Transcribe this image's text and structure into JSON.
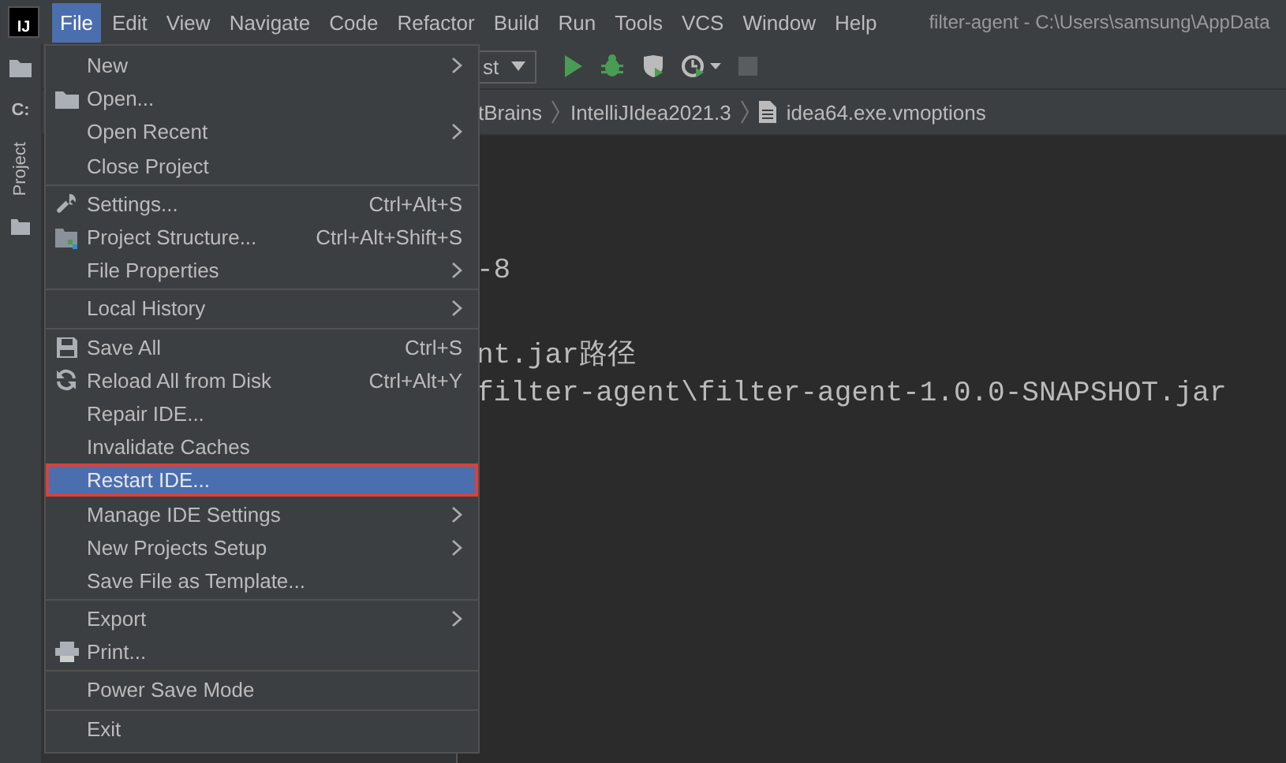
{
  "app_logo": "IJ",
  "menubar": [
    {
      "label": "File",
      "selected": true
    },
    {
      "label": "Edit",
      "selected": false
    },
    {
      "label": "View",
      "selected": false
    },
    {
      "label": "Navigate",
      "selected": false
    },
    {
      "label": "Code",
      "selected": false
    },
    {
      "label": "Refactor",
      "selected": false
    },
    {
      "label": "Build",
      "selected": false
    },
    {
      "label": "Run",
      "selected": false
    },
    {
      "label": "Tools",
      "selected": false
    },
    {
      "label": "VCS",
      "selected": false
    },
    {
      "label": "Window",
      "selected": false
    },
    {
      "label": "Help",
      "selected": false
    }
  ],
  "window": {
    "title": "filter-agent - C:\\Users\\samsung\\AppData"
  },
  "sidebar": {
    "drive_label": "C:",
    "tab": "Project"
  },
  "toolbar": {
    "config_text": "st"
  },
  "breadcrumbs": [
    "tBrains",
    "IntelliJIdea2021.3",
    "idea64.exe.vmoptions"
  ],
  "editor": {
    "lines": [
      "-8",
      "nt.jar路径",
      "filter-agent\\filter-agent-1.0.0-SNAPSHOT.jar"
    ]
  },
  "file_menu": [
    {
      "kind": "plain",
      "label": "New",
      "submenu": true,
      "selected": false,
      "outlined": false
    },
    {
      "kind": "folder",
      "label": "Open...",
      "submenu": false,
      "selected": false,
      "outlined": false
    },
    {
      "kind": "plain",
      "label": "Open Recent",
      "submenu": true,
      "selected": false,
      "outlined": false
    },
    {
      "kind": "plain",
      "label": "Close Project",
      "submenu": false,
      "selected": false,
      "outlined": false
    },
    {
      "kind": "separator"
    },
    {
      "kind": "wrench",
      "label": "Settings...",
      "shortcut": "Ctrl+Alt+S",
      "submenu": false,
      "selected": false,
      "outlined": false
    },
    {
      "kind": "structure",
      "label": "Project Structure...",
      "shortcut": "Ctrl+Alt+Shift+S",
      "submenu": false,
      "selected": false,
      "outlined": false
    },
    {
      "kind": "plain",
      "label": "File Properties",
      "submenu": true,
      "selected": false,
      "outlined": false
    },
    {
      "kind": "separator"
    },
    {
      "kind": "plain",
      "label": "Local History",
      "submenu": true,
      "selected": false,
      "outlined": false
    },
    {
      "kind": "separator"
    },
    {
      "kind": "save",
      "label": "Save All",
      "shortcut": "Ctrl+S",
      "submenu": false,
      "selected": false,
      "outlined": false
    },
    {
      "kind": "reload",
      "label": "Reload All from Disk",
      "shortcut": "Ctrl+Alt+Y",
      "submenu": false,
      "selected": false,
      "outlined": false
    },
    {
      "kind": "plain",
      "label": "Repair IDE...",
      "submenu": false,
      "selected": false,
      "outlined": false
    },
    {
      "kind": "plain",
      "label": "Invalidate Caches",
      "submenu": false,
      "selected": false,
      "outlined": false
    },
    {
      "kind": "plain",
      "label": "Restart IDE...",
      "submenu": false,
      "selected": true,
      "outlined": true
    },
    {
      "kind": "plain",
      "label": "Manage IDE Settings",
      "submenu": true,
      "selected": false,
      "outlined": false
    },
    {
      "kind": "plain",
      "label": "New Projects Setup",
      "submenu": true,
      "selected": false,
      "outlined": false
    },
    {
      "kind": "plain",
      "label": "Save File as Template...",
      "submenu": false,
      "selected": false,
      "outlined": false
    },
    {
      "kind": "separator"
    },
    {
      "kind": "plain",
      "label": "Export",
      "submenu": true,
      "selected": false,
      "outlined": false
    },
    {
      "kind": "printer",
      "label": "Print...",
      "submenu": false,
      "selected": false,
      "outlined": false
    },
    {
      "kind": "separator"
    },
    {
      "kind": "plain",
      "label": "Power Save Mode",
      "submenu": false,
      "selected": false,
      "outlined": false
    },
    {
      "kind": "separator"
    },
    {
      "kind": "plain",
      "label": "Exit",
      "submenu": false,
      "selected": false,
      "outlined": false
    }
  ]
}
